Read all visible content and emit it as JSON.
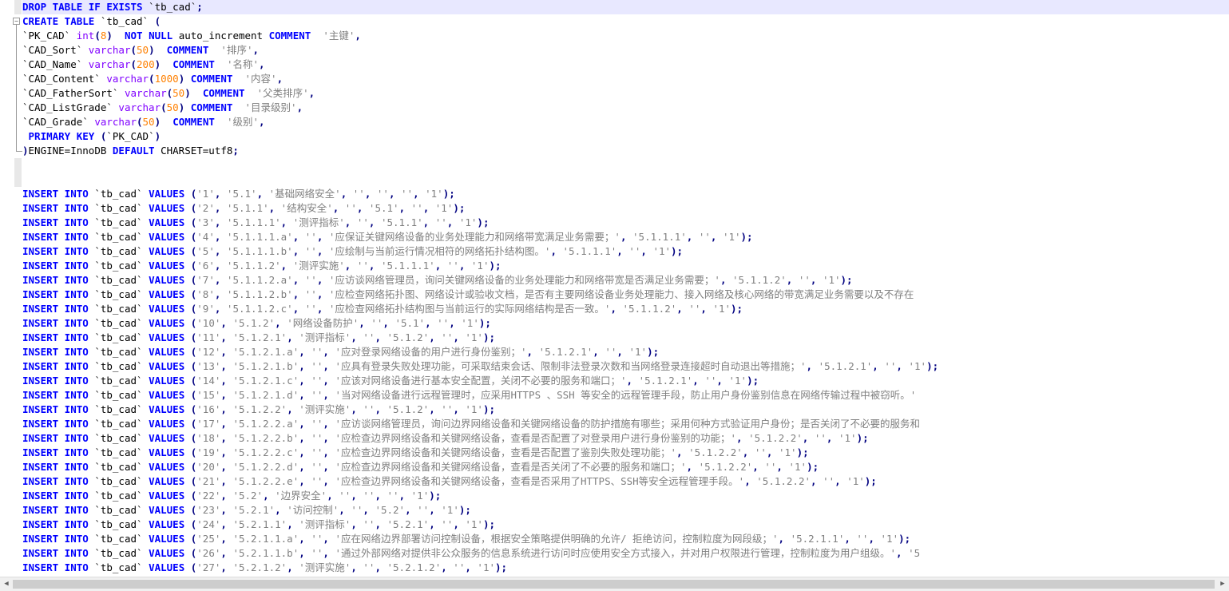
{
  "lines": [
    {
      "current": true,
      "tokens": [
        {
          "t": "kw",
          "v": "DROP TABLE IF EXISTS"
        },
        {
          "t": "tx",
          "v": " `tb_cad`"
        },
        {
          "t": "op",
          "v": ";"
        }
      ]
    },
    {
      "tokens": [
        {
          "t": "kw",
          "v": "CREATE TABLE"
        },
        {
          "t": "tx",
          "v": " `tb_cad` "
        },
        {
          "t": "op",
          "v": "("
        }
      ]
    },
    {
      "tokens": [
        {
          "t": "tx",
          "v": "`PK_CAD` "
        },
        {
          "t": "ty",
          "v": "int"
        },
        {
          "t": "op",
          "v": "("
        },
        {
          "t": "nm",
          "v": "8"
        },
        {
          "t": "op",
          "v": ")"
        },
        {
          "t": "tx",
          "v": "  "
        },
        {
          "t": "kw",
          "v": "NOT NULL"
        },
        {
          "t": "tx",
          "v": " auto_increment "
        },
        {
          "t": "kw",
          "v": "COMMENT"
        },
        {
          "t": "tx",
          "v": "  "
        },
        {
          "t": "st",
          "v": "'主键'"
        },
        {
          "t": "op",
          "v": ","
        }
      ]
    },
    {
      "tokens": [
        {
          "t": "tx",
          "v": "`CAD_Sort` "
        },
        {
          "t": "ty",
          "v": "varchar"
        },
        {
          "t": "op",
          "v": "("
        },
        {
          "t": "nm",
          "v": "50"
        },
        {
          "t": "op",
          "v": ")"
        },
        {
          "t": "tx",
          "v": "  "
        },
        {
          "t": "kw",
          "v": "COMMENT"
        },
        {
          "t": "tx",
          "v": "  "
        },
        {
          "t": "st",
          "v": "'排序'"
        },
        {
          "t": "op",
          "v": ","
        }
      ]
    },
    {
      "tokens": [
        {
          "t": "tx",
          "v": "`CAD_Name` "
        },
        {
          "t": "ty",
          "v": "varchar"
        },
        {
          "t": "op",
          "v": "("
        },
        {
          "t": "nm",
          "v": "200"
        },
        {
          "t": "op",
          "v": ")"
        },
        {
          "t": "tx",
          "v": "  "
        },
        {
          "t": "kw",
          "v": "COMMENT"
        },
        {
          "t": "tx",
          "v": "  "
        },
        {
          "t": "st",
          "v": "'名称'"
        },
        {
          "t": "op",
          "v": ","
        }
      ]
    },
    {
      "tokens": [
        {
          "t": "tx",
          "v": "`CAD_Content` "
        },
        {
          "t": "ty",
          "v": "varchar"
        },
        {
          "t": "op",
          "v": "("
        },
        {
          "t": "nm",
          "v": "1000"
        },
        {
          "t": "op",
          "v": ")"
        },
        {
          "t": "tx",
          "v": " "
        },
        {
          "t": "kw",
          "v": "COMMENT"
        },
        {
          "t": "tx",
          "v": "  "
        },
        {
          "t": "st",
          "v": "'内容'"
        },
        {
          "t": "op",
          "v": ","
        }
      ]
    },
    {
      "tokens": [
        {
          "t": "tx",
          "v": "`CAD_FatherSort` "
        },
        {
          "t": "ty",
          "v": "varchar"
        },
        {
          "t": "op",
          "v": "("
        },
        {
          "t": "nm",
          "v": "50"
        },
        {
          "t": "op",
          "v": ")"
        },
        {
          "t": "tx",
          "v": "  "
        },
        {
          "t": "kw",
          "v": "COMMENT"
        },
        {
          "t": "tx",
          "v": "  "
        },
        {
          "t": "st",
          "v": "'父类排序'"
        },
        {
          "t": "op",
          "v": ","
        }
      ]
    },
    {
      "tokens": [
        {
          "t": "tx",
          "v": "`CAD_ListGrade` "
        },
        {
          "t": "ty",
          "v": "varchar"
        },
        {
          "t": "op",
          "v": "("
        },
        {
          "t": "nm",
          "v": "50"
        },
        {
          "t": "op",
          "v": ")"
        },
        {
          "t": "tx",
          "v": " "
        },
        {
          "t": "kw",
          "v": "COMMENT"
        },
        {
          "t": "tx",
          "v": "  "
        },
        {
          "t": "st",
          "v": "'目录级别'"
        },
        {
          "t": "op",
          "v": ","
        }
      ]
    },
    {
      "tokens": [
        {
          "t": "tx",
          "v": "`CAD_Grade` "
        },
        {
          "t": "ty",
          "v": "varchar"
        },
        {
          "t": "op",
          "v": "("
        },
        {
          "t": "nm",
          "v": "50"
        },
        {
          "t": "op",
          "v": ")"
        },
        {
          "t": "tx",
          "v": "  "
        },
        {
          "t": "kw",
          "v": "COMMENT"
        },
        {
          "t": "tx",
          "v": "  "
        },
        {
          "t": "st",
          "v": "'级别'"
        },
        {
          "t": "op",
          "v": ","
        }
      ]
    },
    {
      "tokens": [
        {
          "t": "tx",
          "v": " "
        },
        {
          "t": "kw",
          "v": "PRIMARY KEY"
        },
        {
          "t": "tx",
          "v": " "
        },
        {
          "t": "op",
          "v": "("
        },
        {
          "t": "tx",
          "v": "`PK_CAD`"
        },
        {
          "t": "op",
          "v": ")"
        }
      ]
    },
    {
      "tokens": [
        {
          "t": "op",
          "v": ")"
        },
        {
          "t": "tx",
          "v": "ENGINE=InnoDB "
        },
        {
          "t": "kw",
          "v": "DEFAULT"
        },
        {
          "t": "tx",
          "v": " CHARSET=utf8"
        },
        {
          "t": "op",
          "v": ";"
        }
      ]
    },
    {
      "tokens": []
    },
    {
      "tokens": []
    },
    {
      "insert": [
        "'1'",
        "'5.1'",
        "'基础网络安全'",
        "''",
        "''",
        "''",
        "'1'"
      ]
    },
    {
      "insert": [
        "'2'",
        "'5.1.1'",
        "'结构安全'",
        "''",
        "'5.1'",
        "''",
        "'1'"
      ]
    },
    {
      "insert": [
        "'3'",
        "'5.1.1.1'",
        "'测评指标'",
        "''",
        "'5.1.1'",
        "''",
        "'1'"
      ]
    },
    {
      "insert": [
        "'4'",
        "'5.1.1.1.a'",
        "''",
        "'应保证关键网络设备的业务处理能力和网络带宽满足业务需要；'",
        "'5.1.1.1'",
        "''",
        "'1'"
      ]
    },
    {
      "insert": [
        "'5'",
        "'5.1.1.1.b'",
        "''",
        "'应绘制与当前运行情况相符的网络拓扑结构图。'",
        "'5.1.1.1'",
        "''",
        "'1'"
      ]
    },
    {
      "insert": [
        "'6'",
        "'5.1.1.2'",
        "'测评实施'",
        "''",
        "'5.1.1.1'",
        "''",
        "'1'"
      ]
    },
    {
      "insert": [
        "'7'",
        "'5.1.1.2.a'",
        "''",
        "'应访谈网络管理员，询问关键网络设备的业务处理能力和网络带宽是否满足业务需要；'",
        "'5.1.1.2'",
        "''",
        "'1'"
      ]
    },
    {
      "insert": [
        "'8'",
        "'5.1.1.2.b'",
        "''",
        "'应检查网络拓扑图、网络设计或验收文档，是否有主要网络设备业务处理能力、接入网络及核心网络的带宽满足业务需要以及不存在"
      ]
    },
    {
      "insert": [
        "'9'",
        "'5.1.1.2.c'",
        "''",
        "'应检查网络拓扑结构图与当前运行的实际网络结构是否一致。'",
        "'5.1.1.2'",
        "''",
        "'1'"
      ]
    },
    {
      "insert": [
        "'10'",
        "'5.1.2'",
        "'网络设备防护'",
        "''",
        "'5.1'",
        "''",
        "'1'"
      ]
    },
    {
      "insert": [
        "'11'",
        "'5.1.2.1'",
        "'测评指标'",
        "''",
        "'5.1.2'",
        "''",
        "'1'"
      ]
    },
    {
      "insert": [
        "'12'",
        "'5.1.2.1.a'",
        "''",
        "'应对登录网络设备的用户进行身份鉴别；'",
        "'5.1.2.1'",
        "''",
        "'1'"
      ]
    },
    {
      "insert": [
        "'13'",
        "'5.1.2.1.b'",
        "''",
        "'应具有登录失败处理功能，可采取结束会话、限制非法登录次数和当网络登录连接超时自动退出等措施；'",
        "'5.1.2.1'",
        "''",
        "'1'"
      ]
    },
    {
      "insert": [
        "'14'",
        "'5.1.2.1.c'",
        "''",
        "'应该对网络设备进行基本安全配置，关闭不必要的服务和端口；'",
        "'5.1.2.1'",
        "''",
        "'1'"
      ]
    },
    {
      "insert": [
        "'15'",
        "'5.1.2.1.d'",
        "''",
        "'当对网络设备进行远程管理时，应采用HTTPS 、SSH 等安全的远程管理手段，防止用户身份鉴别信息在网络传输过程中被窃听。'"
      ]
    },
    {
      "insert": [
        "'16'",
        "'5.1.2.2'",
        "'测评实施'",
        "''",
        "'5.1.2'",
        "''",
        "'1'"
      ]
    },
    {
      "insert": [
        "'17'",
        "'5.1.2.2.a'",
        "''",
        "'应访谈网络管理员，询问边界网络设备和关键网络设备的防护措施有哪些；采用何种方式验证用户身份；是否关闭了不必要的服务和"
      ]
    },
    {
      "insert": [
        "'18'",
        "'5.1.2.2.b'",
        "''",
        "'应检查边界网络设备和关键网络设备，查看是否配置了对登录用户进行身份鉴别的功能；'",
        "'5.1.2.2'",
        "''",
        "'1'"
      ]
    },
    {
      "insert": [
        "'19'",
        "'5.1.2.2.c'",
        "''",
        "'应检查边界网络设备和关键网络设备，查看是否配置了鉴别失败处理功能；'",
        "'5.1.2.2'",
        "''",
        "'1'"
      ]
    },
    {
      "insert": [
        "'20'",
        "'5.1.2.2.d'",
        "''",
        "'应检查边界网络设备和关键网络设备，查看是否关闭了不必要的服务和端口；'",
        "'5.1.2.2'",
        "''",
        "'1'"
      ]
    },
    {
      "insert": [
        "'21'",
        "'5.1.2.2.e'",
        "''",
        "'应检查边界网络设备和关键网络设备，查看是否采用了HTTPS、SSH等安全远程管理手段。'",
        "'5.1.2.2'",
        "''",
        "'1'"
      ]
    },
    {
      "insert": [
        "'22'",
        "'5.2'",
        "'边界安全'",
        "''",
        "''",
        "''",
        "'1'"
      ]
    },
    {
      "insert": [
        "'23'",
        "'5.2.1'",
        "'访问控制'",
        "''",
        "'5.2'",
        "''",
        "'1'"
      ]
    },
    {
      "insert": [
        "'24'",
        "'5.2.1.1'",
        "'测评指标'",
        "''",
        "'5.2.1'",
        "''",
        "'1'"
      ]
    },
    {
      "insert": [
        "'25'",
        "'5.2.1.1.a'",
        "''",
        "'应在网络边界部署访问控制设备，根据安全策略提供明确的允许/ 拒绝访问，控制粒度为网段级；'",
        "'5.2.1.1'",
        "''",
        "'1'"
      ]
    },
    {
      "insert": [
        "'26'",
        "'5.2.1.1.b'",
        "''",
        "'通过外部网络对提供非公众服务的信息系统进行访问时应使用安全方式接入，并对用户权限进行管理，控制粒度为用户组级。'",
        "'5"
      ]
    },
    {
      "insert": [
        "'27'",
        "'5.2.1.2'",
        "'测评实施'",
        "''",
        "'5.2.1.2'",
        "''",
        "'1'"
      ]
    }
  ],
  "insert_prefix": {
    "kw1": "INSERT INTO",
    "table": " `tb_cad` ",
    "kw2": "VALUES",
    "space": " "
  },
  "scrollbar": {
    "left_arrow": "◀",
    "right_arrow": "▶"
  },
  "colors": {
    "keyword": "#0000ff",
    "type": "#8000ff",
    "number": "#ff8000",
    "string": "#808080",
    "current_line": "#e8e8ff"
  }
}
